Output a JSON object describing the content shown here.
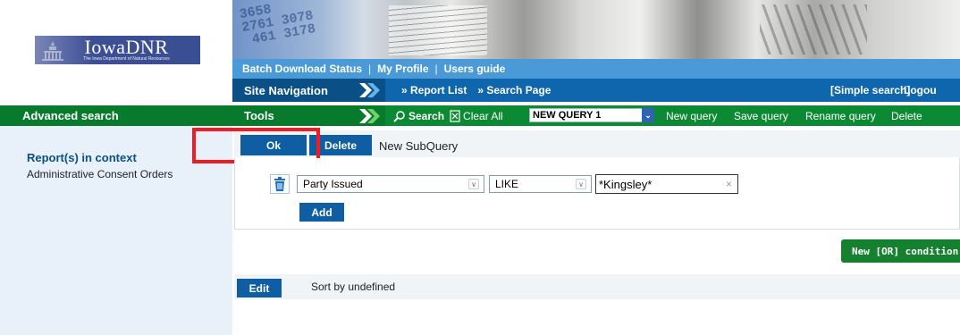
{
  "logo": {
    "name": "IowaDNR",
    "subtitle": "The Iowa Department of Natural Resources"
  },
  "banner": {
    "digits": "3658\n2761 3078\n 461 3178"
  },
  "top_links": [
    "Batch Download Status",
    "My Profile",
    "Users guide"
  ],
  "site_nav": {
    "label": "Site Navigation",
    "report_list": "» Report List",
    "search_page": "» Search Page",
    "simple_search": "[Simple search]",
    "logout": "Logou"
  },
  "advanced_search_label": "Advanced search",
  "tools": {
    "label": "Tools",
    "search": "Search",
    "clear_all": "Clear All",
    "query_name": "NEW QUERY 1",
    "new_query": "New query",
    "save_query": "Save query",
    "rename_query": "Rename query",
    "delete": "Delete"
  },
  "left_panel": {
    "title": "Report(s) in context",
    "item": "Administrative Consent Orders"
  },
  "subquery": {
    "ok": "Ok",
    "delete": "Delete",
    "new_subquery": "New SubQuery"
  },
  "condition": {
    "field": "Party Issued",
    "operator": "LIKE",
    "value": "*Kingsley*",
    "add": "Add"
  },
  "or_condition": "New [OR] condition",
  "sort": {
    "edit": "Edit",
    "text": "Sort by undefined"
  },
  "colors": {
    "blue_dark": "#0b4f87",
    "blue": "#0f66ad",
    "green": "#087a2c",
    "highlight": "#ee1c24"
  }
}
